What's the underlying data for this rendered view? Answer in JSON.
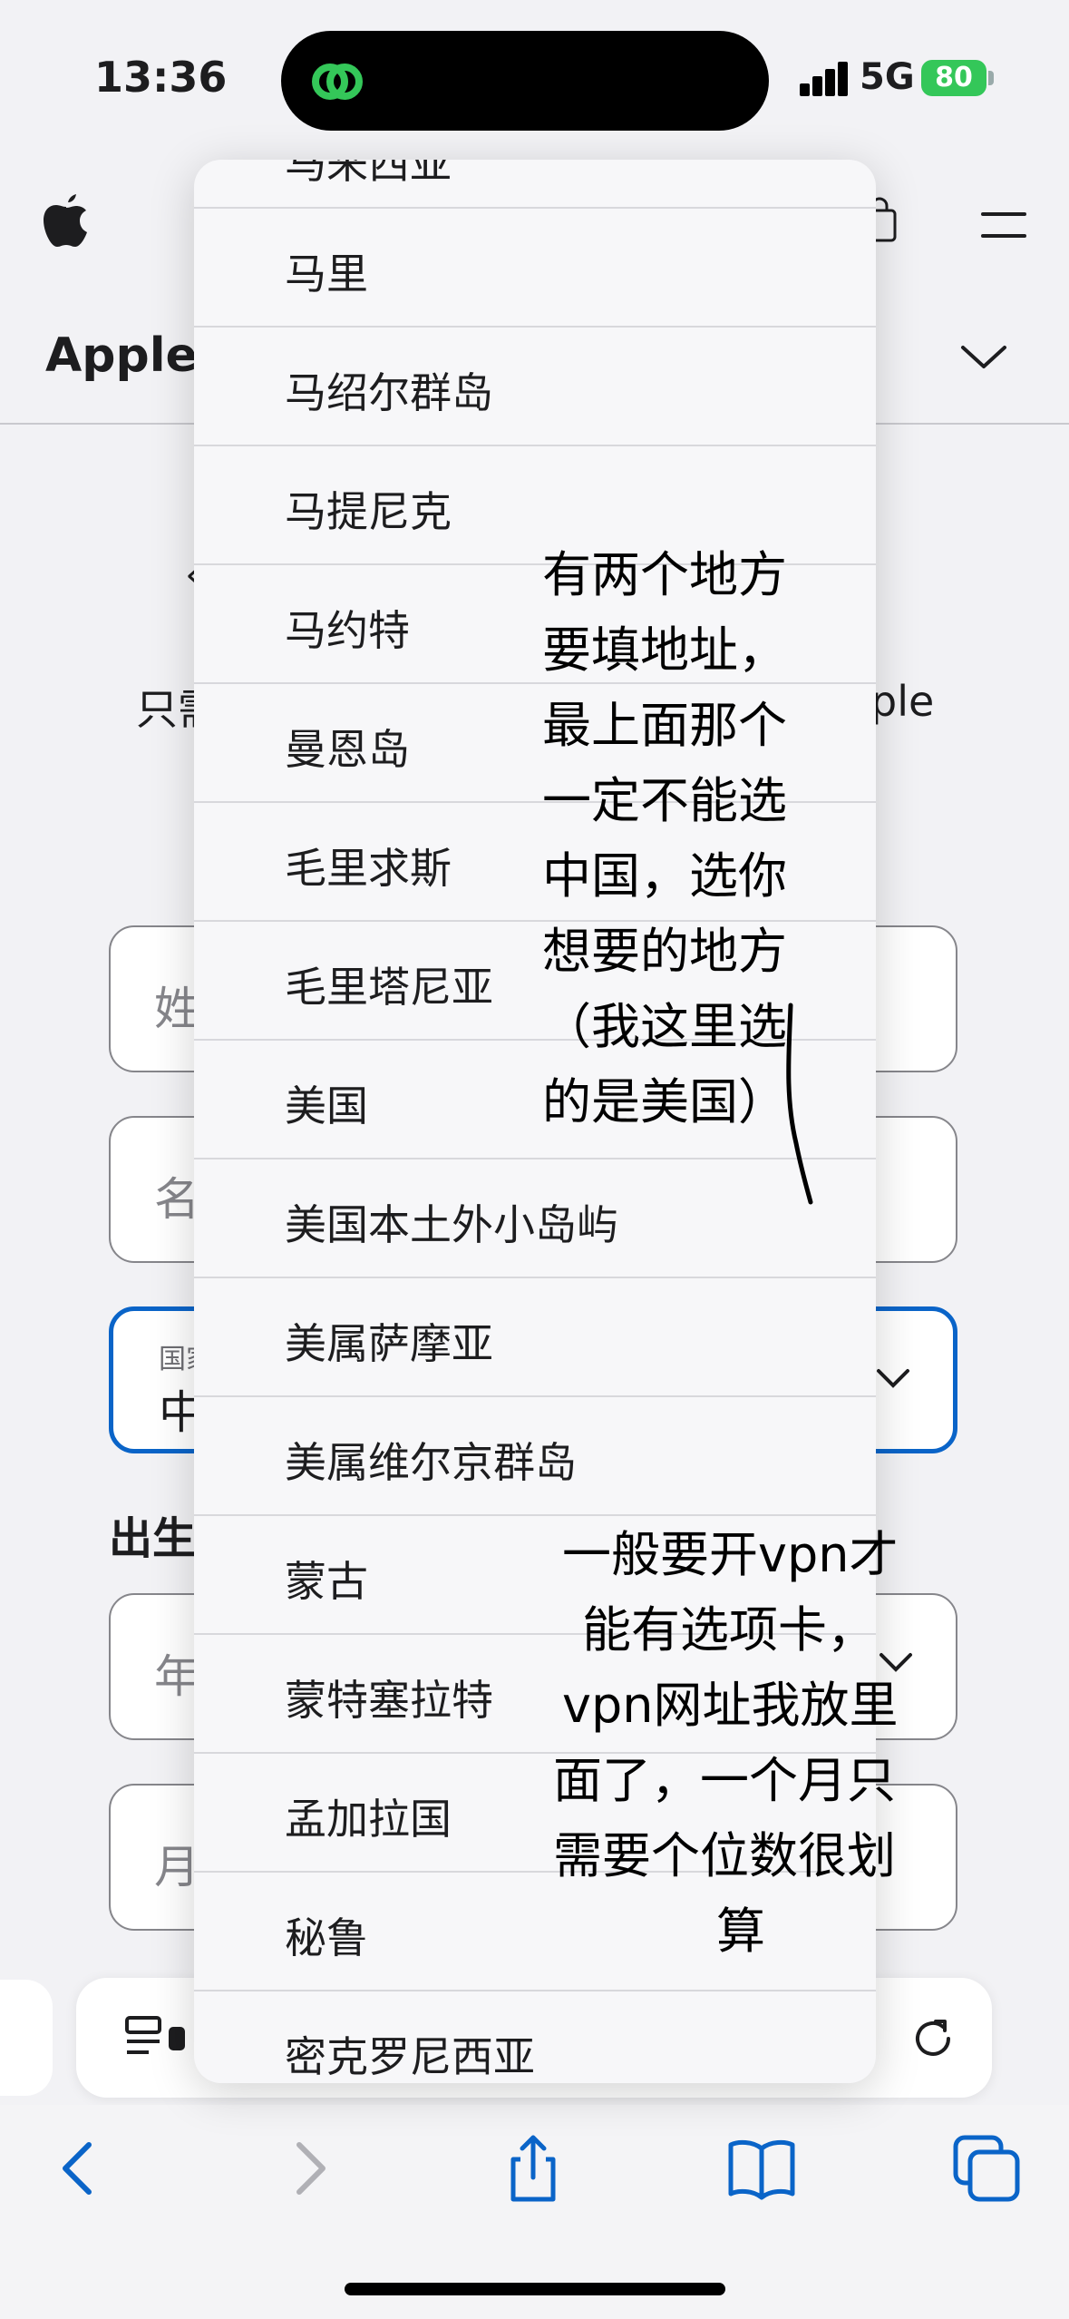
{
  "status_bar": {
    "time": "13:36",
    "network": "5G",
    "battery": "80"
  },
  "header": {
    "section_title": "Apple ID",
    "section_title_visible": "Apple",
    "icons": [
      "apple-logo",
      "bag-icon",
      "menu-icon",
      "chevron-down-icon"
    ]
  },
  "form": {
    "partial_texts": {
      "arrow": "‹",
      "intro_left": "只需",
      "intro_right": "ple"
    },
    "last_name": {
      "placeholder": "姓"
    },
    "first_name": {
      "placeholder": "名"
    },
    "country": {
      "label": "国家",
      "value": "中"
    },
    "birthday_label": "出生",
    "year": {
      "placeholder": "年"
    },
    "month": {
      "placeholder": "月"
    }
  },
  "picker": {
    "cut_off_item": "马来西亚",
    "options": [
      "马里",
      "马绍尔群岛",
      "马提尼克",
      "马约特",
      "曼恩岛",
      "毛里求斯",
      "毛里塔尼亚",
      "美国",
      "美国本土外小岛屿",
      "美属萨摩亚",
      "美属维尔京群岛",
      "蒙古",
      "蒙特塞拉特",
      "孟加拉国",
      "秘鲁",
      "密克罗尼西亚"
    ]
  },
  "annotations": {
    "note_1": [
      "有两个地方",
      "要填地址，",
      "最上面那个",
      "一定不能选",
      "中国，选你",
      "想要的地方",
      "（我这里选",
      "的是美国）"
    ],
    "note_2": [
      "一般要开vpn才",
      "能有选项卡，",
      "vpn网址我放里",
      "面了，一个月只",
      "需要个位数很划",
      "算"
    ]
  },
  "toolbar": {
    "icons": [
      "reader-icon",
      "reload-icon",
      "back-icon",
      "forward-icon",
      "share-icon",
      "bookmarks-icon",
      "tabs-icon"
    ]
  },
  "colors": {
    "accent": "#0a64c8",
    "battery": "#34c759",
    "app_icon": "#34c759"
  }
}
